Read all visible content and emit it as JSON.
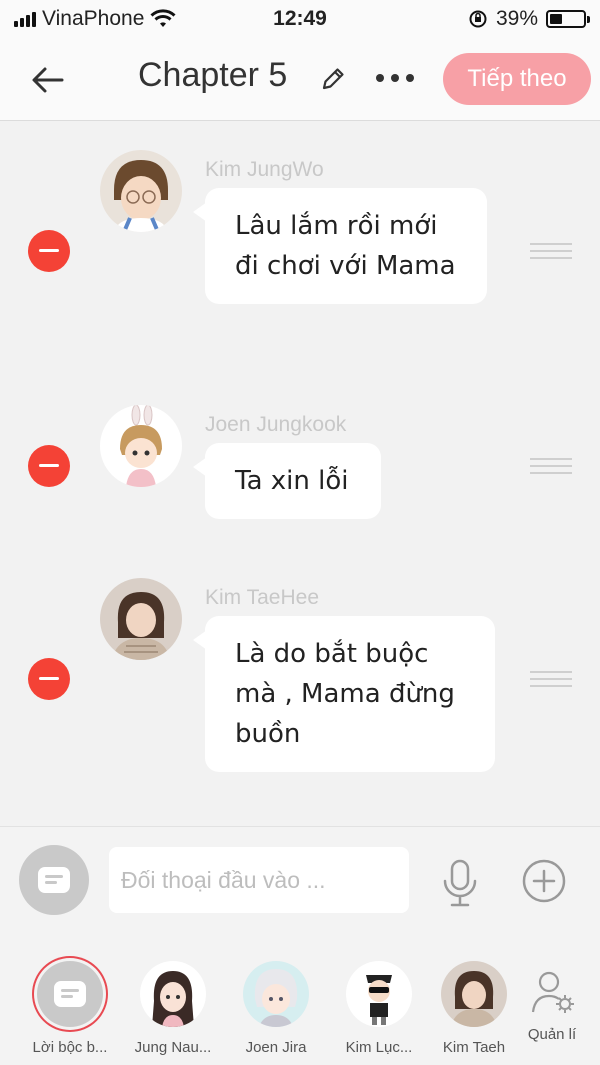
{
  "status_bar": {
    "carrier": "VinaPhone",
    "time": "12:49",
    "battery_percent": "39%",
    "battery_level": 0.39
  },
  "header": {
    "back_label": "←",
    "title": "Chapter 5",
    "next_label": "Tiếp theo"
  },
  "messages": [
    {
      "author": "Kim JungWo",
      "text": "Lâu lắm rồi mới đi chơi với Mama"
    },
    {
      "author": "Joen Jungkook",
      "text": "Ta xin lỗi"
    },
    {
      "author": "Kim TaeHee",
      "text": "Là do bắt buộc mà , Mama đừng buồn"
    }
  ],
  "input": {
    "placeholder": "Đối thoại đầu vào ..."
  },
  "characters": [
    {
      "label": "Lời bộc b..."
    },
    {
      "label": "Jung Nau..."
    },
    {
      "label": "Joen Jira"
    },
    {
      "label": "Kim Lục..."
    },
    {
      "label": "Kim Taeh"
    }
  ],
  "manage_label": "Quản lí",
  "colors": {
    "accent": "#f7a0a6",
    "delete": "#f44236",
    "selected_ring": "#e84a52"
  }
}
